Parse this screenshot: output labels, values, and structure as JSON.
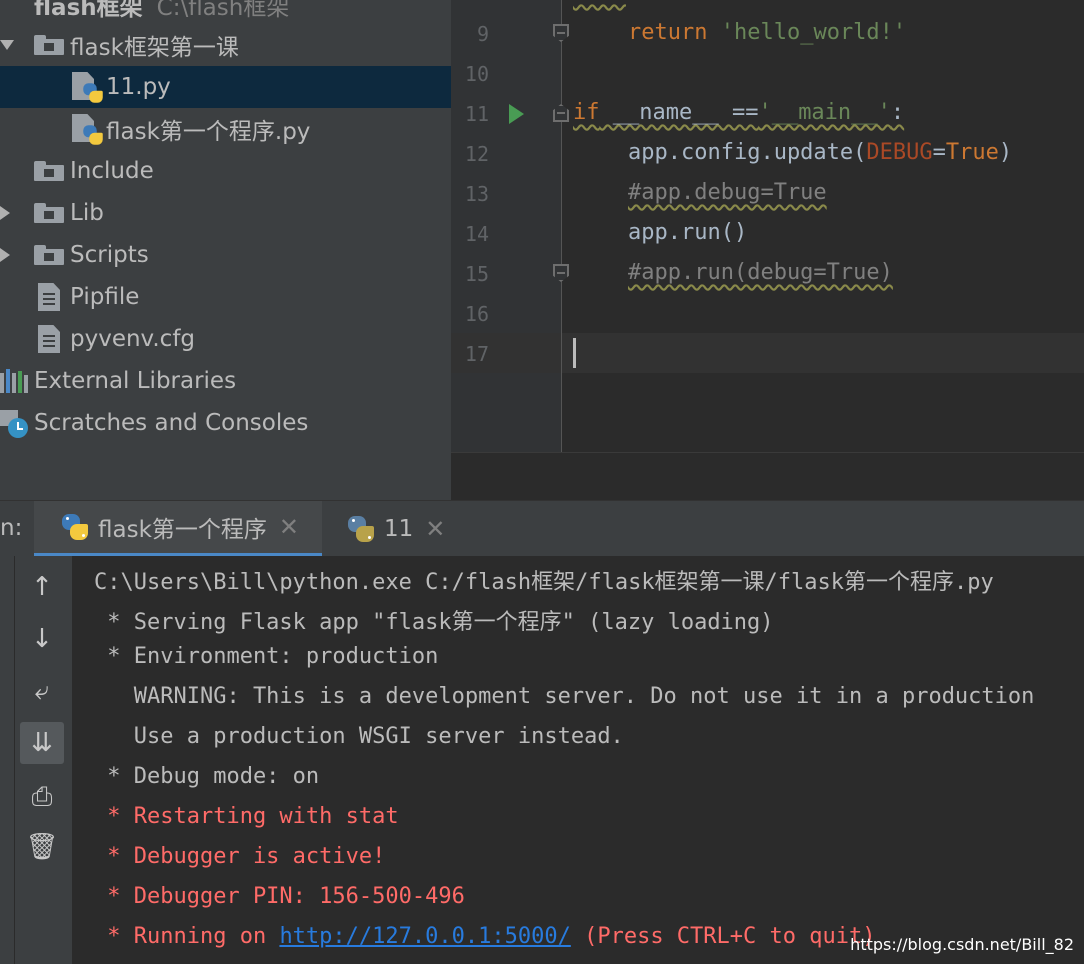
{
  "project_tree": {
    "root": {
      "label": "flash框架",
      "path": "C:\\flash框架"
    },
    "items": [
      {
        "label": "flask框架第一课"
      },
      {
        "label": "11.py"
      },
      {
        "label": "flask第一个程序.py"
      },
      {
        "label": "Include"
      },
      {
        "label": "Lib"
      },
      {
        "label": "Scripts"
      },
      {
        "label": "Pipfile"
      },
      {
        "label": "pyvenv.cfg"
      },
      {
        "label": "External Libraries"
      },
      {
        "label": "Scratches and Consoles"
      }
    ]
  },
  "editor": {
    "line_numbers": [
      "9",
      "10",
      "11",
      "12",
      "13",
      "14",
      "15",
      "16",
      "17"
    ],
    "code": {
      "l9_kw": "return",
      "l9_str": "'hello_world!'",
      "l11_kw": "if",
      "l11_a": " __name__ ==",
      "l11_str": "'__main__'",
      "l11_b": ":",
      "l12_a": "app.config.update(",
      "l12_param": "DEBUG",
      "l12_b": "=",
      "l12_kw": "True",
      "l12_c": ")",
      "l13": "#app.debug=True",
      "l14": "app.run()",
      "l15": "#app.run(debug=True)"
    }
  },
  "run_panel": {
    "label": "n:",
    "tabs": [
      {
        "label": "flask第一个程序",
        "close": "✕"
      },
      {
        "label": "11",
        "close": "✕"
      }
    ],
    "toolbar": {
      "up": "↑",
      "down": "↓",
      "wrap": "⤶",
      "scroll_end": "⇊",
      "print": "⎙",
      "trash": "🗑"
    }
  },
  "console": {
    "lines": [
      "C:\\Users\\Bill\\python.exe C:/flash框架/flask框架第一课/flask第一个程序.py",
      " * Serving Flask app \"flask第一个程序\" (lazy loading)",
      " * Environment: production",
      "   WARNING: This is a development server. Do not use it in a production",
      "   Use a production WSGI server instead.",
      " * Debug mode: on",
      " * Restarting with stat",
      " * Debugger is active!",
      " * Debugger PIN: 156-500-496"
    ],
    "running_prefix": " * Running on ",
    "url": "http://127.0.0.1:5000/",
    "running_suffix": " (Press CTRL+C to quit)"
  },
  "watermark": "https://blog.csdn.net/Bill_82",
  "colors": {
    "keyword": "#cc7832",
    "string": "#6a8759",
    "comment": "#808080",
    "error": "#ff6b68",
    "link": "#287bde",
    "selection": "#0d293e"
  }
}
